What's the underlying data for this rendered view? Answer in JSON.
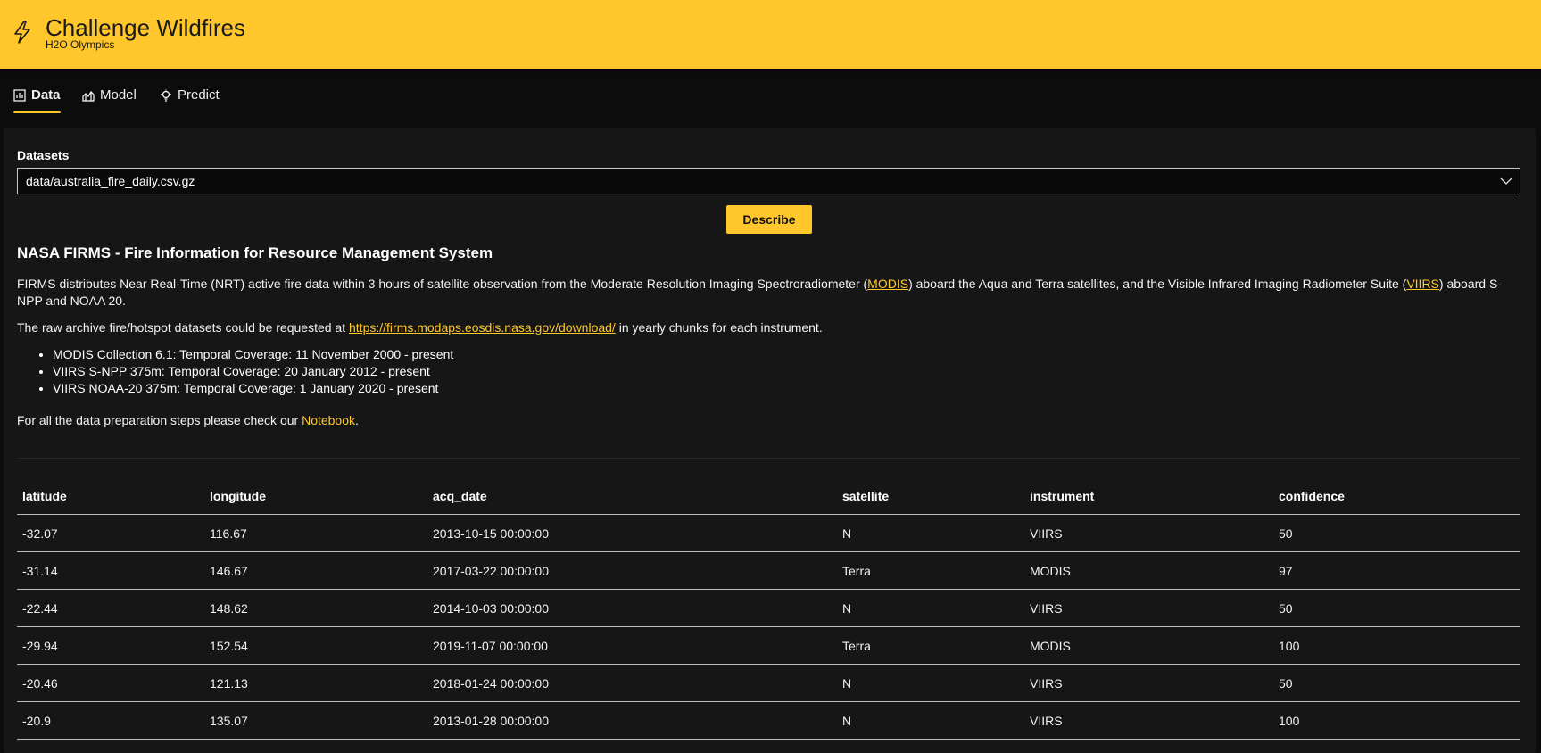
{
  "header": {
    "title": "Challenge Wildfires",
    "subtitle": "H2O Olympics",
    "icon": "lightning-icon",
    "accent": "#ffc72b"
  },
  "tabs": [
    {
      "label": "Data",
      "icon": "chart-icon",
      "active": true
    },
    {
      "label": "Model",
      "icon": "model-icon",
      "active": false
    },
    {
      "label": "Predict",
      "icon": "lightbulb-icon",
      "active": false
    }
  ],
  "datasets": {
    "label": "Datasets",
    "selected": "data/australia_fire_daily.csv.gz"
  },
  "describe_button": "Describe",
  "description": {
    "heading": "NASA FIRMS - Fire Information for Resource Management System",
    "p1_before": "FIRMS distributes Near Real-Time (NRT) active fire data within 3 hours of satellite observation from the Moderate Resolution Imaging Spectroradiometer (",
    "p1_link1": "MODIS",
    "p1_middle": ") aboard the Aqua and Terra satellites, and the Visible Infrared Imaging Radiometer Suite (",
    "p1_link2": "VIIRS",
    "p1_after": ") aboard S-NPP and NOAA 20.",
    "p2_before": "The raw archive fire/hotspot datasets could be requested at ",
    "p2_link": "https://firms.modaps.eosdis.nasa.gov/download/",
    "p2_after": " in yearly chunks for each instrument.",
    "bullets": [
      "MODIS Collection 6.1: Temporal Coverage: 11 November 2000 - present",
      "VIIRS S-NPP 375m: Temporal Coverage: 20 January 2012 - present",
      "VIIRS NOAA-20 375m: Temporal Coverage: 1 January 2020 - present"
    ],
    "p3_before": "For all the data preparation steps please check our ",
    "p3_link": "Notebook",
    "p3_after": "."
  },
  "table": {
    "columns": [
      "latitude",
      "longitude",
      "acq_date",
      "satellite",
      "instrument",
      "confidence"
    ],
    "rows": [
      [
        "-32.07",
        "116.67",
        "2013-10-15 00:00:00",
        "N",
        "VIIRS",
        "50"
      ],
      [
        "-31.14",
        "146.67",
        "2017-03-22 00:00:00",
        "Terra",
        "MODIS",
        "97"
      ],
      [
        "-22.44",
        "148.62",
        "2014-10-03 00:00:00",
        "N",
        "VIIRS",
        "50"
      ],
      [
        "-29.94",
        "152.54",
        "2019-11-07 00:00:00",
        "Terra",
        "MODIS",
        "100"
      ],
      [
        "-20.46",
        "121.13",
        "2018-01-24 00:00:00",
        "N",
        "VIIRS",
        "50"
      ],
      [
        "-20.9",
        "135.07",
        "2013-01-28 00:00:00",
        "N",
        "VIIRS",
        "100"
      ]
    ]
  }
}
